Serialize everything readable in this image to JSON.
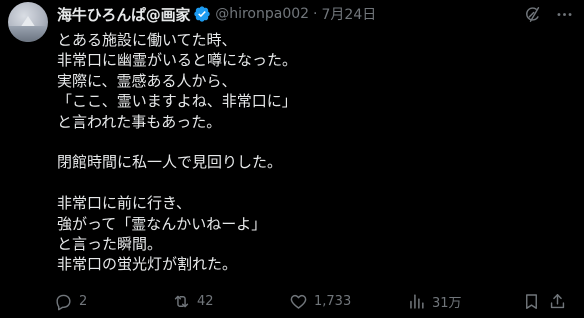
{
  "author": {
    "display_name": "海牛ひろんぱ@画家",
    "handle": "@hironpa002",
    "separator": "·",
    "date": "7月24日"
  },
  "body_lines": [
    "とある施設に働いてた時、",
    "非常口に幽霊がいると噂になった。",
    "実際に、霊感ある人から、",
    "「ここ、霊いますよね、非常口に」",
    "と言われた事もあった。",
    "",
    "閉館時間に私一人で見回りした。",
    "",
    "非常口に前に行き、",
    "強がって「霊なんかいねーよ」",
    "と言った瞬間。",
    "非常口の蛍光灯が割れた。"
  ],
  "actions": {
    "reply_count": "2",
    "repost_count": "42",
    "like_count": "1,733",
    "views_count": "31万"
  },
  "icons": {
    "verified": "verified-badge-icon",
    "grok": "grok-icon",
    "more": "more-icon",
    "reply": "reply-icon",
    "repost": "repost-icon",
    "like": "heart-icon",
    "views": "views-icon",
    "bookmark": "bookmark-icon",
    "share": "share-icon"
  },
  "colors": {
    "background": "#000000",
    "text": "#e7e9ea",
    "muted": "#71767b",
    "verified": "#1d9bf0"
  }
}
